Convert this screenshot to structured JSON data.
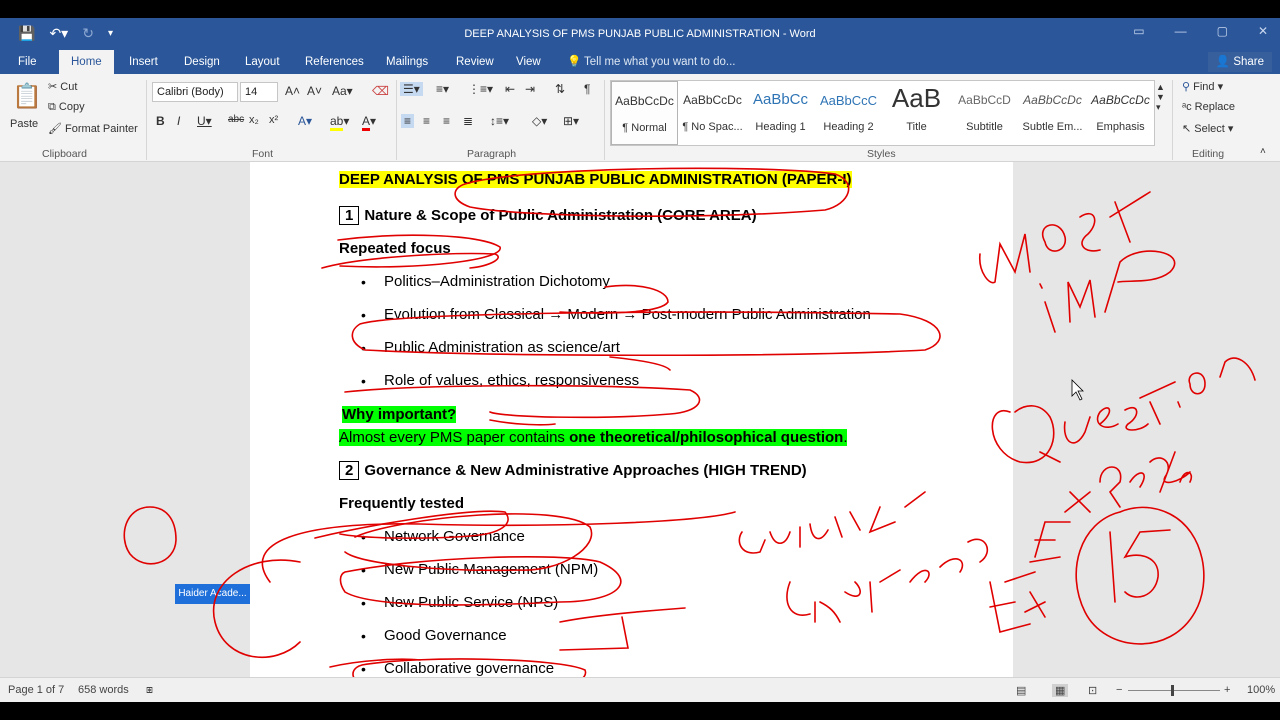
{
  "app": {
    "title": "DEEP ANALYSIS OF PMS PUNJAB PUBLIC ADMINISTRATION - Word",
    "share_label": "Share"
  },
  "tabs": [
    "File",
    "Home",
    "Insert",
    "Design",
    "Layout",
    "References",
    "Mailings",
    "Review",
    "View"
  ],
  "tell_me": "Tell me what you want to do...",
  "clipboard": {
    "paste": "Paste",
    "cut": "Cut",
    "copy": "Copy",
    "format_painter": "Format Painter",
    "label": "Clipboard"
  },
  "font": {
    "name": "Calibri (Body)",
    "size": "14",
    "label": "Font"
  },
  "paragraph": {
    "label": "Paragraph"
  },
  "styles": {
    "label": "Styles",
    "items": [
      {
        "sample": "AaBbCcDc",
        "name": "¶ Normal"
      },
      {
        "sample": "AaBbCcDc",
        "name": "¶ No Spac..."
      },
      {
        "sample": "AaBbCc",
        "name": "Heading 1"
      },
      {
        "sample": "AaBbCcC",
        "name": "Heading 2"
      },
      {
        "sample": "AaB",
        "name": "Title"
      },
      {
        "sample": "AaBbCcD",
        "name": "Subtitle"
      },
      {
        "sample": "AaBbCcDc",
        "name": "Subtle Em..."
      },
      {
        "sample": "AaBbCcDc",
        "name": "Emphasis"
      }
    ]
  },
  "editing": {
    "find": "Find",
    "replace": "Replace",
    "select": "Select",
    "label": "Editing"
  },
  "document": {
    "title_line": "DEEP ANALYSIS OF PMS PUNJAB PUBLIC ADMINISTRATION (PAPER-I)",
    "section1_num": "1",
    "section1": "Nature & Scope of Public Administration (CORE AREA)",
    "repeated_focus": "Repeated focus",
    "s1_bullets": [
      "Politics–Administration Dichotomy",
      "Evolution from Classical → Modern → Post-modern Public Administration",
      "Public Administration as science/art",
      "Role of values, ethics, responsiveness"
    ],
    "why_important": "Why important?",
    "why_text_a": "Almost every PMS paper contains ",
    "why_text_b": "one theoretical/philosophical question",
    "why_text_c": ".",
    "section2_num": "2",
    "section2": "Governance & New Administrative Approaches (HIGH TREND)",
    "frequently_tested": "Frequently tested",
    "s2_bullets": [
      "Network Governance",
      "New Public Management (NPM)",
      "New Public Service (NPS)",
      "Good Governance",
      "Collaborative governance"
    ]
  },
  "tooltip": "Haider Acade...",
  "status": {
    "page": "Page 1 of 7",
    "words": "658 words",
    "zoom": "100%"
  },
  "colors": {
    "brand": "#2b579a",
    "ink": "#e00000",
    "highlight_yellow": "#ffff00",
    "highlight_green": "#00ff00"
  }
}
